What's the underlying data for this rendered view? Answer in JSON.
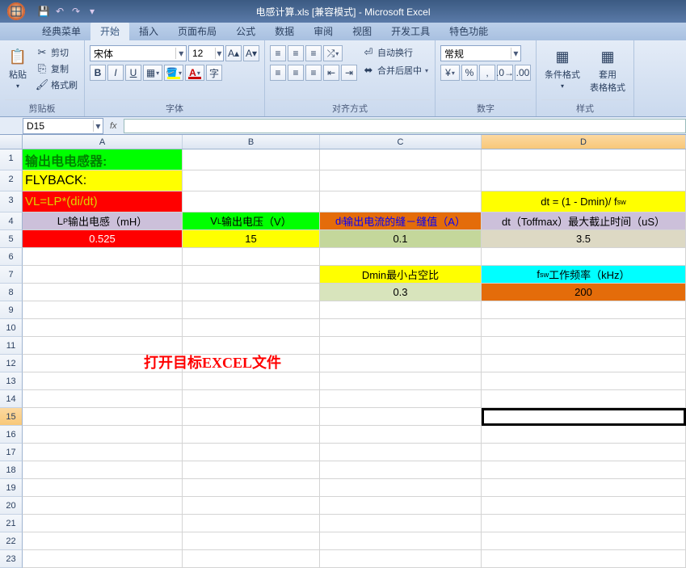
{
  "titlebar": {
    "title": "电感计算.xls [兼容模式] - Microsoft Excel"
  },
  "tabs": [
    "经典菜单",
    "开始",
    "插入",
    "页面布局",
    "公式",
    "数据",
    "审阅",
    "视图",
    "开发工具",
    "特色功能"
  ],
  "active_tab": 1,
  "ribbon": {
    "clipboard": {
      "label": "剪贴板",
      "paste": "粘贴",
      "cut": "剪切",
      "copy": "复制",
      "painter": "格式刷"
    },
    "font": {
      "label": "字体",
      "name": "宋体",
      "size": "12"
    },
    "align": {
      "label": "对齐方式",
      "wrap": "自动换行",
      "merge": "合并后居中"
    },
    "number": {
      "label": "数字",
      "format": "常规"
    },
    "styles": {
      "label": "样式",
      "cond": "条件格式",
      "table": "套用\n表格格式"
    }
  },
  "namebox": "D15",
  "columns": [
    "A",
    "B",
    "C",
    "D"
  ],
  "rows_count": 23,
  "cells": {
    "A1": "输出电电感器:",
    "A2": "FLYBACK:",
    "A3": "VL=LP*(di/dt)",
    "D3": "dt = (1 - Dmin)/ f",
    "D3_sub": "sw",
    "A4": "L",
    "A4_sub": "P",
    "A4_rest": "输出电感（mH）",
    "B4": "V",
    "B4_sub": "L",
    "B4_rest": "输出电压（V）",
    "C4": "d",
    "C4_rest": "输出电流的缝－缝值（A）",
    "D4": "dt（Toffmax）最大截止时间（uS）",
    "A5": "0.525",
    "B5": "15",
    "C5": "0.1",
    "D5": "3.5",
    "C7": "Dmin最小占空比",
    "D7": "f",
    "D7_sub": "sw",
    "D7_rest": "工作频率（kHz）",
    "C8": "0.3",
    "D8": "200"
  },
  "annotation": "打开目标EXCEL文件",
  "selection": {
    "col": "D",
    "row": 15
  },
  "chart_data": {
    "type": "table",
    "title": "输出电电感器 FLYBACK VL=LP*(di/dt)",
    "columns": [
      "LP输出电感（mH）",
      "VL输出电压（V）",
      "di输出电流的缝－缝值（A）",
      "dt（Toffmax）最大截止时间（uS）"
    ],
    "values": [
      0.525,
      15,
      0.1,
      3.5
    ],
    "derived": {
      "Dmin最小占空比": 0.3,
      "fsw工作频率（kHz）": 200
    },
    "formula": "dt = (1 - Dmin)/ fsw"
  }
}
